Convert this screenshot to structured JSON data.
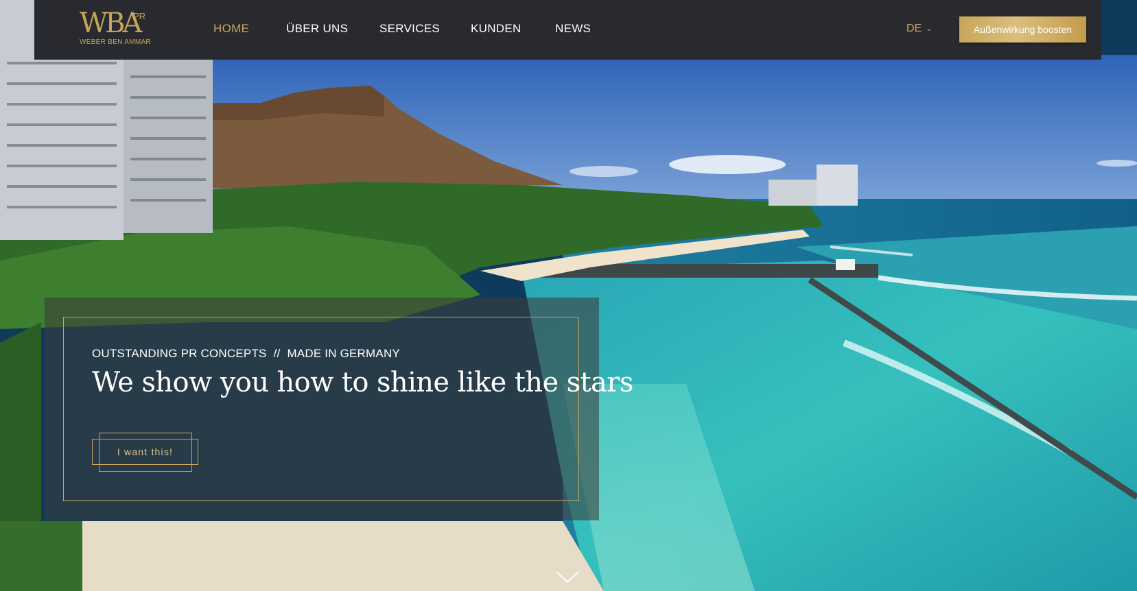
{
  "header": {
    "logo": {
      "mark": "WBA",
      "superscript": "PR",
      "subtitle": "WEBER BEN AMMAR"
    },
    "nav": [
      {
        "label": "HOME",
        "active": true
      },
      {
        "label": "ÜBER UNS",
        "active": false
      },
      {
        "label": "SERVICES",
        "active": false
      },
      {
        "label": "KUNDEN",
        "active": false
      },
      {
        "label": "NEWS",
        "active": false
      }
    ],
    "language": {
      "label": "DE",
      "icon": "chevron-down-icon"
    },
    "cta_label": "Außenwirkung boosten"
  },
  "hero": {
    "eyebrow_left": "OUTSTANDING PR CONCEPTS",
    "eyebrow_separator": "//",
    "eyebrow_right": "MADE IN GERMANY",
    "headline": "We show you how to shine like the stars",
    "button_label": "I want this!"
  },
  "scroll_icon": "chevron-down-icon",
  "colors": {
    "header_bg": "#282a30",
    "accent_gold": "#c9a85f",
    "nav_text": "#ffffff",
    "hero_panel": "rgba(60,60,58,0.58)"
  }
}
